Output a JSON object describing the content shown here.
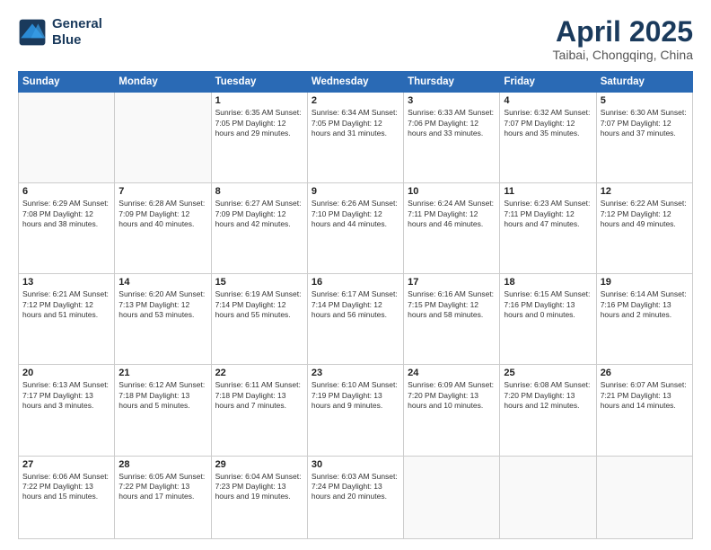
{
  "logo": {
    "line1": "General",
    "line2": "Blue"
  },
  "title": "April 2025",
  "subtitle": "Taibai, Chongqing, China",
  "weekdays": [
    "Sunday",
    "Monday",
    "Tuesday",
    "Wednesday",
    "Thursday",
    "Friday",
    "Saturday"
  ],
  "weeks": [
    [
      {
        "day": "",
        "content": ""
      },
      {
        "day": "",
        "content": ""
      },
      {
        "day": "1",
        "content": "Sunrise: 6:35 AM\nSunset: 7:05 PM\nDaylight: 12 hours and 29 minutes."
      },
      {
        "day": "2",
        "content": "Sunrise: 6:34 AM\nSunset: 7:05 PM\nDaylight: 12 hours and 31 minutes."
      },
      {
        "day": "3",
        "content": "Sunrise: 6:33 AM\nSunset: 7:06 PM\nDaylight: 12 hours and 33 minutes."
      },
      {
        "day": "4",
        "content": "Sunrise: 6:32 AM\nSunset: 7:07 PM\nDaylight: 12 hours and 35 minutes."
      },
      {
        "day": "5",
        "content": "Sunrise: 6:30 AM\nSunset: 7:07 PM\nDaylight: 12 hours and 37 minutes."
      }
    ],
    [
      {
        "day": "6",
        "content": "Sunrise: 6:29 AM\nSunset: 7:08 PM\nDaylight: 12 hours and 38 minutes."
      },
      {
        "day": "7",
        "content": "Sunrise: 6:28 AM\nSunset: 7:09 PM\nDaylight: 12 hours and 40 minutes."
      },
      {
        "day": "8",
        "content": "Sunrise: 6:27 AM\nSunset: 7:09 PM\nDaylight: 12 hours and 42 minutes."
      },
      {
        "day": "9",
        "content": "Sunrise: 6:26 AM\nSunset: 7:10 PM\nDaylight: 12 hours and 44 minutes."
      },
      {
        "day": "10",
        "content": "Sunrise: 6:24 AM\nSunset: 7:11 PM\nDaylight: 12 hours and 46 minutes."
      },
      {
        "day": "11",
        "content": "Sunrise: 6:23 AM\nSunset: 7:11 PM\nDaylight: 12 hours and 47 minutes."
      },
      {
        "day": "12",
        "content": "Sunrise: 6:22 AM\nSunset: 7:12 PM\nDaylight: 12 hours and 49 minutes."
      }
    ],
    [
      {
        "day": "13",
        "content": "Sunrise: 6:21 AM\nSunset: 7:12 PM\nDaylight: 12 hours and 51 minutes."
      },
      {
        "day": "14",
        "content": "Sunrise: 6:20 AM\nSunset: 7:13 PM\nDaylight: 12 hours and 53 minutes."
      },
      {
        "day": "15",
        "content": "Sunrise: 6:19 AM\nSunset: 7:14 PM\nDaylight: 12 hours and 55 minutes."
      },
      {
        "day": "16",
        "content": "Sunrise: 6:17 AM\nSunset: 7:14 PM\nDaylight: 12 hours and 56 minutes."
      },
      {
        "day": "17",
        "content": "Sunrise: 6:16 AM\nSunset: 7:15 PM\nDaylight: 12 hours and 58 minutes."
      },
      {
        "day": "18",
        "content": "Sunrise: 6:15 AM\nSunset: 7:16 PM\nDaylight: 13 hours and 0 minutes."
      },
      {
        "day": "19",
        "content": "Sunrise: 6:14 AM\nSunset: 7:16 PM\nDaylight: 13 hours and 2 minutes."
      }
    ],
    [
      {
        "day": "20",
        "content": "Sunrise: 6:13 AM\nSunset: 7:17 PM\nDaylight: 13 hours and 3 minutes."
      },
      {
        "day": "21",
        "content": "Sunrise: 6:12 AM\nSunset: 7:18 PM\nDaylight: 13 hours and 5 minutes."
      },
      {
        "day": "22",
        "content": "Sunrise: 6:11 AM\nSunset: 7:18 PM\nDaylight: 13 hours and 7 minutes."
      },
      {
        "day": "23",
        "content": "Sunrise: 6:10 AM\nSunset: 7:19 PM\nDaylight: 13 hours and 9 minutes."
      },
      {
        "day": "24",
        "content": "Sunrise: 6:09 AM\nSunset: 7:20 PM\nDaylight: 13 hours and 10 minutes."
      },
      {
        "day": "25",
        "content": "Sunrise: 6:08 AM\nSunset: 7:20 PM\nDaylight: 13 hours and 12 minutes."
      },
      {
        "day": "26",
        "content": "Sunrise: 6:07 AM\nSunset: 7:21 PM\nDaylight: 13 hours and 14 minutes."
      }
    ],
    [
      {
        "day": "27",
        "content": "Sunrise: 6:06 AM\nSunset: 7:22 PM\nDaylight: 13 hours and 15 minutes."
      },
      {
        "day": "28",
        "content": "Sunrise: 6:05 AM\nSunset: 7:22 PM\nDaylight: 13 hours and 17 minutes."
      },
      {
        "day": "29",
        "content": "Sunrise: 6:04 AM\nSunset: 7:23 PM\nDaylight: 13 hours and 19 minutes."
      },
      {
        "day": "30",
        "content": "Sunrise: 6:03 AM\nSunset: 7:24 PM\nDaylight: 13 hours and 20 minutes."
      },
      {
        "day": "",
        "content": ""
      },
      {
        "day": "",
        "content": ""
      },
      {
        "day": "",
        "content": ""
      }
    ]
  ]
}
